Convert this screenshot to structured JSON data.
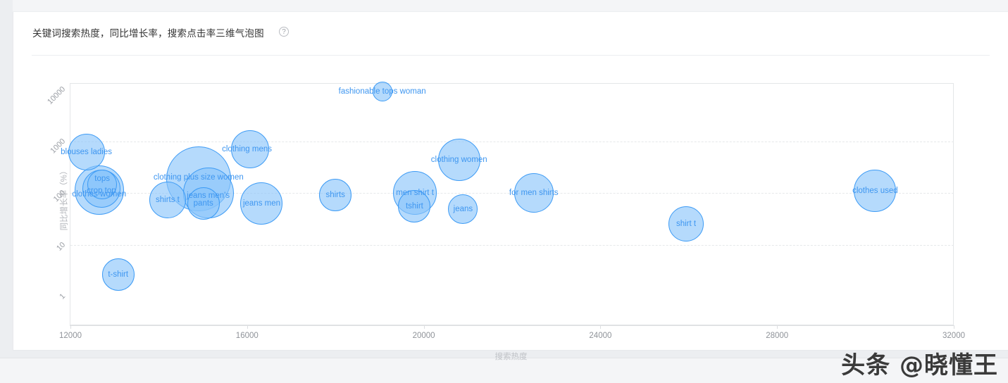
{
  "card": {
    "title": "关键词搜索热度，同比增长率，搜索点击率三维气泡图",
    "help_icon": "help-circle-icon",
    "help_glyph": "?"
  },
  "watermark": "头条 @晓懂王",
  "chart_data": {
    "type": "scatter",
    "title": "关键词搜索热度，同比增长率，搜索点击率三维气泡图",
    "xlabel": "搜索热度",
    "ylabel": "同比增长率（%）",
    "xlim": [
      12000,
      32000
    ],
    "ylim": [
      1,
      10000
    ],
    "yscale": "log",
    "xticks": [
      "12000",
      "16000",
      "20000",
      "24000",
      "28000",
      "32000"
    ],
    "yticks": [
      "1",
      "10",
      "100",
      "1000",
      "10000"
    ],
    "grid": "horizontal-dashed",
    "legend": "none",
    "bubble_fill": "#87c4fa",
    "bubble_stroke": "#3d9bf5",
    "label_color": "#3e96f0",
    "size_encodes": "搜索点击率",
    "points": [
      {
        "label": "blouses ladies",
        "x": 12360,
        "y": 620,
        "r": 26,
        "label_dx": 0,
        "label_dy": 0
      },
      {
        "label": "clothes women",
        "x": 12650,
        "y": 115,
        "r": 35,
        "label_dx": 0,
        "label_dy": 6
      },
      {
        "label": "crop top",
        "x": 12700,
        "y": 120,
        "r": 27,
        "label_dx": 0,
        "label_dy": 3
      },
      {
        "label": "tops",
        "x": 12720,
        "y": 145,
        "r": 21,
        "label_dx": 0,
        "label_dy": -8
      },
      {
        "label": "t-shirt",
        "x": 13080,
        "y": 2.6,
        "r": 23,
        "label_dx": 0,
        "label_dy": 0
      },
      {
        "label": "shirts t",
        "x": 14200,
        "y": 72,
        "r": 26,
        "label_dx": 0,
        "label_dy": 0
      },
      {
        "label": "clothing plus size women",
        "x": 14900,
        "y": 190,
        "r": 46,
        "label_dx": 0,
        "label_dy": -2
      },
      {
        "label": "jeans men's",
        "x": 15120,
        "y": 100,
        "r": 36,
        "label_dx": 0,
        "label_dy": 4
      },
      {
        "label": "pants",
        "x": 15010,
        "y": 62,
        "r": 23,
        "label_dx": 0,
        "label_dy": 0
      },
      {
        "label": "clothing mens",
        "x": 16060,
        "y": 700,
        "r": 27,
        "label_dx": -4,
        "label_dy": 0
      },
      {
        "label": "jeans men",
        "x": 16330,
        "y": 62,
        "r": 30,
        "label_dx": 0,
        "label_dy": 0
      },
      {
        "label": "fashionable tops woman",
        "x": 19060,
        "y": 9000,
        "r": 14,
        "label_dx": 0,
        "label_dy": 0
      },
      {
        "label": "shirts",
        "x": 18000,
        "y": 90,
        "r": 23,
        "label_dx": 0,
        "label_dy": 0
      },
      {
        "label": "men shirt t",
        "x": 19800,
        "y": 100,
        "r": 31,
        "label_dx": 0,
        "label_dy": 0
      },
      {
        "label": "tshirt",
        "x": 19790,
        "y": 55,
        "r": 23,
        "label_dx": 0,
        "label_dy": 0
      },
      {
        "label": "clothing women",
        "x": 20800,
        "y": 430,
        "r": 30,
        "label_dx": 0,
        "label_dy": 0
      },
      {
        "label": "jeans",
        "x": 20890,
        "y": 48,
        "r": 21,
        "label_dx": 0,
        "label_dy": 0
      },
      {
        "label": "for men shirts",
        "x": 22490,
        "y": 100,
        "r": 28,
        "label_dx": 0,
        "label_dy": 0
      },
      {
        "label": "shirt t",
        "x": 25940,
        "y": 25,
        "r": 25,
        "label_dx": 0,
        "label_dy": 0
      },
      {
        "label": "clothes used",
        "x": 30220,
        "y": 110,
        "r": 30,
        "label_dx": 0,
        "label_dy": 0
      }
    ]
  }
}
